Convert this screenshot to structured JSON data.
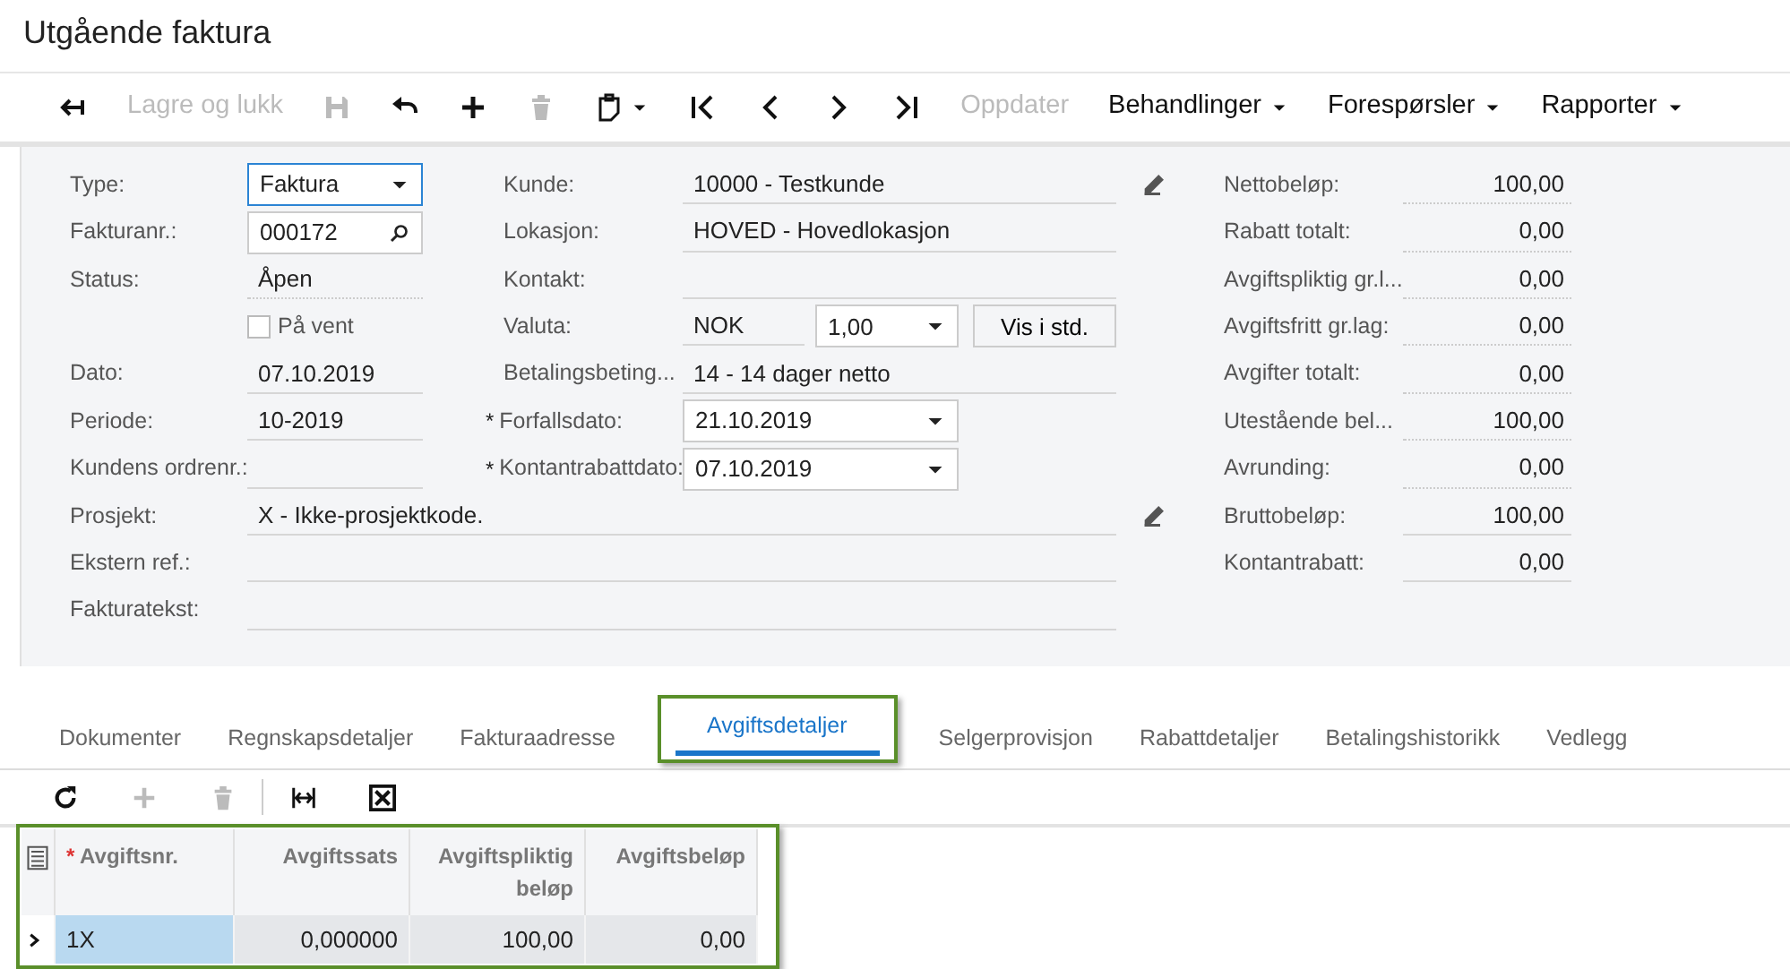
{
  "window": {
    "title": "Utgående faktura"
  },
  "toolbar": [
    {
      "kind": "icon",
      "disabled": false
    },
    {
      "kind": "text",
      "label": "Lagre og lukk",
      "disabled": true
    },
    {
      "kind": "icon",
      "disabled": true
    },
    {
      "kind": "icon",
      "disabled": false
    },
    {
      "kind": "icon",
      "disabled": false
    },
    {
      "kind": "icon",
      "disabled": true
    },
    {
      "kind": "icon-menu",
      "disabled": false
    },
    {
      "kind": "icon",
      "disabled": false
    },
    {
      "kind": "icon",
      "disabled": false
    },
    {
      "kind": "icon",
      "disabled": false
    },
    {
      "kind": "icon",
      "disabled": false
    },
    {
      "kind": "text",
      "label": "Oppdater",
      "disabled": true
    },
    {
      "kind": "menu",
      "label": "Behandlinger",
      "disabled": false
    },
    {
      "kind": "menu",
      "label": "Forespørsler",
      "disabled": false
    },
    {
      "kind": "menu",
      "label": "Rapporter",
      "disabled": false
    }
  ],
  "left_fields": [
    {
      "kind": "select",
      "label": "Type:",
      "value": "Faktura",
      "focused": true
    },
    {
      "kind": "search",
      "label": "Fakturanr.:",
      "value": "000172",
      "focused": false
    },
    {
      "kind": "readonly",
      "label": "Status:",
      "value": "Åpen"
    },
    {
      "kind": "checkbox",
      "label": "På vent",
      "checked": false
    },
    {
      "kind": "text",
      "label": "Dato:",
      "value": "07.10.2019"
    },
    {
      "kind": "text",
      "label": "Periode:",
      "value": "10-2019"
    },
    {
      "kind": "text",
      "label": "Kundens ordrenr.:"
    }
  ],
  "middle_fields": [
    {
      "kind": "text",
      "label": "Kunde:",
      "value": "10000 - Testkunde",
      "editable": true
    },
    {
      "kind": "text",
      "label": "Lokasjon:",
      "value": "HOVED - Hovedlokasjon",
      "editable": false
    },
    {
      "kind": "text",
      "label": "Kontakt:",
      "editable": false
    },
    {
      "kind": "currency",
      "label": "Valuta:",
      "value": "NOK",
      "rate": "1,00",
      "button": "Vis i std.",
      "editable": false
    },
    {
      "kind": "text",
      "label": "Betalingsbeting...",
      "value": "14 - 14 dager netto",
      "editable": false
    },
    {
      "kind": "date",
      "label": "Forfallsdato:",
      "marker": "*",
      "value": "21.10.2019",
      "editable": false
    },
    {
      "kind": "date",
      "label": "Kontantrabattdato:",
      "marker": "*",
      "value": "07.10.2019",
      "editable": false
    }
  ],
  "wide_fields": [
    {
      "label": "Prosjekt:",
      "value": "X - Ikke-prosjektkode.",
      "editable": true
    },
    {
      "label": "Ekstern ref.:",
      "editable": false
    },
    {
      "label": "Fakturatekst:",
      "editable": false
    }
  ],
  "totals": [
    {
      "label": "Nettobeløp:",
      "value": "100,00"
    },
    {
      "label": "Rabatt totalt:",
      "value": "0,00"
    },
    {
      "label": "Avgiftspliktig gr.l...",
      "value": "0,00"
    },
    {
      "label": "Avgiftsfritt gr.lag:",
      "value": "0,00"
    },
    {
      "label": "Avgifter totalt:",
      "value": "0,00"
    },
    {
      "label": "Utestående bel...",
      "value": "100,00"
    },
    {
      "label": "Avrunding:",
      "value": "0,00"
    },
    {
      "label": "Bruttobeløp:",
      "value": "100,00"
    },
    {
      "label": "Kontantrabatt:",
      "value": "0,00"
    }
  ],
  "tabs": [
    {
      "label": "Dokumenter",
      "selected": false
    },
    {
      "label": "Regnskapsdetaljer",
      "selected": false
    },
    {
      "label": "Fakturaadresse",
      "selected": false
    },
    {
      "label": "Avgiftsdetaljer",
      "selected": true
    },
    {
      "label": "Selgerprovisjon",
      "selected": false
    },
    {
      "label": "Rabattdetaljer",
      "selected": false
    },
    {
      "label": "Betalingshistorikk",
      "selected": false
    },
    {
      "label": "Vedlegg",
      "selected": false
    }
  ],
  "grid_toolbar": [
    {
      "disabled": false
    },
    {
      "disabled": true
    },
    {
      "disabled": true
    },
    {
      "disabled": false
    },
    {
      "disabled": false
    }
  ],
  "table": {
    "columns": [
      {
        "label": "Avgiftsnr.",
        "marker": "*"
      },
      {
        "label": "Avgiftssats"
      },
      {
        "label": "Avgiftspliktig beløp"
      },
      {
        "label": "Avgiftsbeløp"
      }
    ],
    "rows": [
      {
        "active": true,
        "cells": [
          "1X",
          "0,000000",
          "100,00",
          "0,00"
        ]
      }
    ]
  }
}
